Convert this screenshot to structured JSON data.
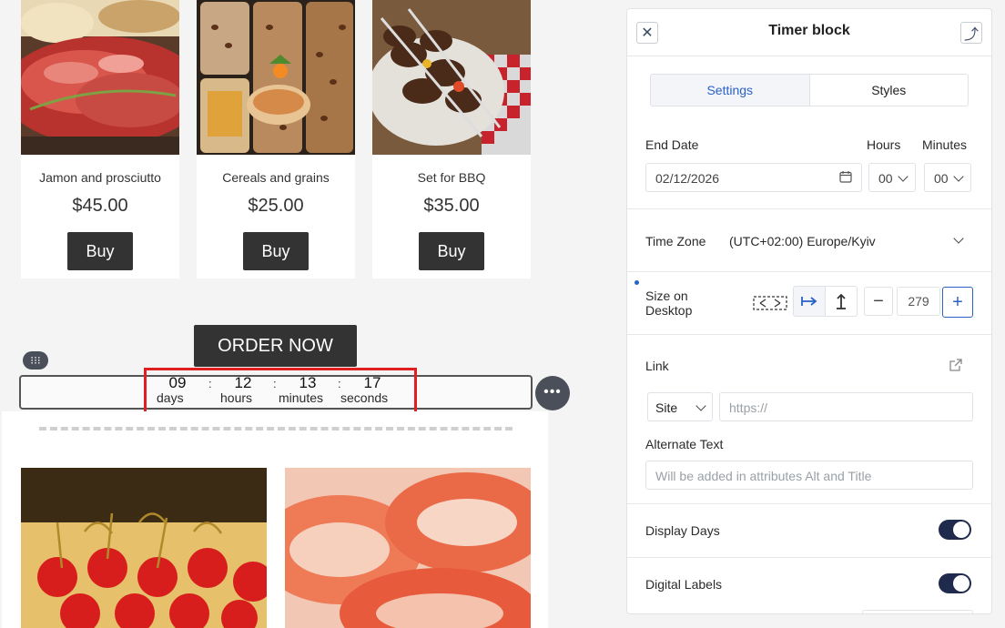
{
  "products": [
    {
      "name": "Jamon and prosciutto",
      "price": "$45.00",
      "buy": "Buy"
    },
    {
      "name": "Cereals and grains",
      "price": "$25.00",
      "buy": "Buy"
    },
    {
      "name": "Set for BBQ",
      "price": "$35.00",
      "buy": "Buy"
    }
  ],
  "order_button": "ORDER NOW",
  "timer": {
    "items": [
      {
        "value": "09",
        "label": "days"
      },
      {
        "value": "12",
        "label": "hours"
      },
      {
        "value": "13",
        "label": "minutes"
      },
      {
        "value": "17",
        "label": "seconds"
      }
    ],
    "separator": ":"
  },
  "panel": {
    "title": "Timer block",
    "tabs": [
      "Settings",
      "Styles"
    ],
    "active_tab": "Settings",
    "end_date_label": "End Date",
    "hours_label": "Hours",
    "minutes_label": "Minutes",
    "end_date_value": "02/12/2026",
    "hours_value": "00",
    "minutes_value": "00",
    "timezone_label": "Time Zone",
    "timezone_value": "(UTC+02:00) Europe/Kyiv",
    "size_label": "Size on Desktop",
    "size_value": "279",
    "link_label": "Link",
    "link_type": "Site",
    "link_placeholder": "https://",
    "alt_label": "Alternate Text",
    "alt_placeholder": "Will be added in attributes Alt and Title",
    "display_days_label": "Display Days",
    "display_days_on": true,
    "digital_labels_label": "Digital Labels",
    "digital_labels_on": true
  },
  "colors": {
    "accent": "#2a62c9",
    "toggle": "#1f2a4d",
    "highlight": "#e02020",
    "button": "#333333"
  }
}
